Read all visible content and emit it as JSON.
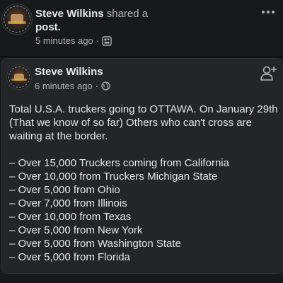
{
  "share_header": {
    "author": "Steve Wilkins",
    "verb": " shared a",
    "object": "post.",
    "time": "5 minutes ago",
    "dot": "·",
    "audience_icon": "group-audience-icon",
    "more_icon": "more-options-icon"
  },
  "post": {
    "author": "Steve Wilkins",
    "time": "6 minutes ago",
    "dot": "·",
    "audience_icon": "globe-icon",
    "add_friend_icon": "add-friend-icon",
    "text": "Total U.S.A. truckers going to OTTAWA. On January 29th (That we know of so far) Others who can't cross are waiting at the border.",
    "items": [
      "– Over 15,000 Truckers coming from California",
      "– Over 10,000 from Truckers Michigan State",
      "– Over 5,000 from Ohio",
      "– Over 7,000 from Illinois",
      "– Over 10,000 from Texas",
      "– Over 5,000 from New York",
      "– Over 5,000 from Washington State",
      "– Over 5,000 from Florida"
    ]
  }
}
